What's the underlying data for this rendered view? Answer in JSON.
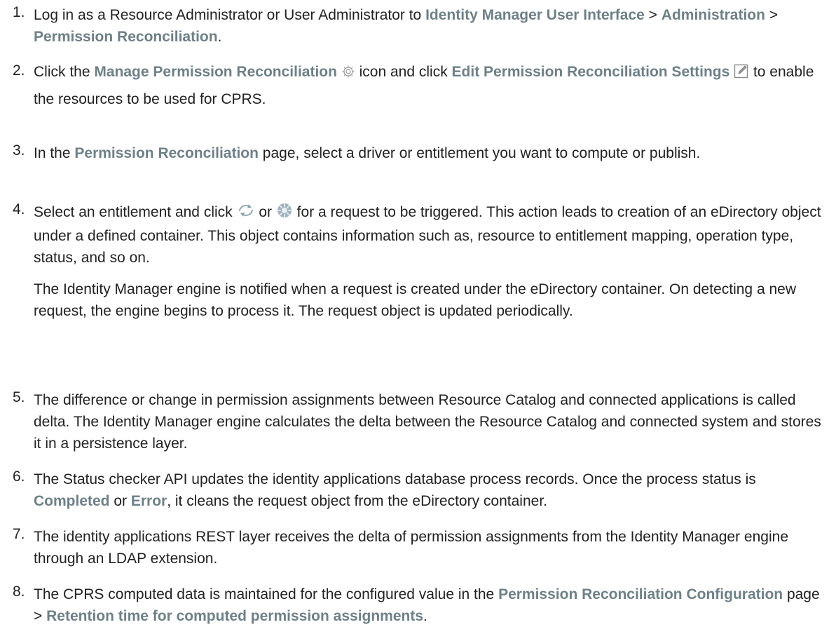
{
  "steps": [
    {
      "num": "1.",
      "parts": [
        "Log in as a Resource Administrator or User Administrator to ",
        "Identity Manager User Interface",
        " > ",
        "Administration",
        " > ",
        "Permission Reconciliation",
        "."
      ]
    },
    {
      "num": "2.",
      "parts": [
        "Click the ",
        "Manage Permission Reconciliation",
        " ",
        " icon and click ",
        "Edit Permission Reconciliation Settings",
        " ",
        " to enable the resources to be used for CPRS."
      ],
      "icons": [
        "gear-icon",
        "edit-icon"
      ]
    },
    {
      "num": "3.",
      "parts": [
        "In the ",
        "Permission Reconciliation",
        " page, select a driver or entitlement you want to compute or publish."
      ]
    },
    {
      "num": "4.",
      "parts": [
        "Select an entitlement and click ",
        " or ",
        " for a request to be triggered. This action leads to creation of an eDirectory object under a defined container. This object contains information such as, resource to entitlement mapping, operation type, status, and so on."
      ],
      "icons": [
        "compute-icon",
        "publish-icon"
      ],
      "followup": "The Identity Manager engine is notified when a request is created under the eDirectory container. On detecting a new request, the engine begins to process it. The request object is updated periodically."
    },
    {
      "num": "5.",
      "text": "The difference or change in permission assignments between Resource Catalog and connected applications is called delta. The Identity Manager engine calculates the delta between the Resource Catalog and connected system and stores it in a persistence layer."
    },
    {
      "num": "6.",
      "parts": [
        "The Status checker API updates the identity applications database process records. Once the process status is ",
        "Completed",
        " or ",
        "Error",
        ", it cleans the request object from the eDirectory container."
      ]
    },
    {
      "num": "7.",
      "text": "The identity applications REST layer receives the delta of permission assignments from the Identity Manager engine through an LDAP extension."
    },
    {
      "num": "8.",
      "parts": [
        "The CPRS computed data is maintained for the configured value in the ",
        "Permission Reconciliation Configuration",
        " page > ",
        "Retention time for computed permission assignments",
        "."
      ]
    }
  ],
  "colors": {
    "ui_term": "#6d8088",
    "body": "#222222"
  }
}
